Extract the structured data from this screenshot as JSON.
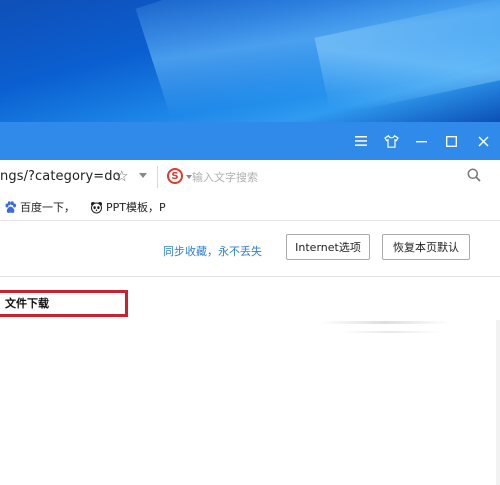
{
  "window_controls": {
    "menu_icon": "menu-icon",
    "skin_icon": "shirt-skin-icon",
    "minimize_icon": "minimize-icon",
    "maximize_icon": "maximize-icon",
    "close_icon": "close-icon"
  },
  "address_bar": {
    "url": "ngs/?category=do",
    "search_engine_icon": "sogou-s-icon",
    "search_placeholder": "输入文字搜索"
  },
  "favorites": [
    {
      "label": "百度一下，",
      "icon": "baidu-paw-icon"
    },
    {
      "label": "PPT模板，P",
      "icon": "panda-icon"
    }
  ],
  "settings": {
    "sync_link": "同步收藏，永不丢失",
    "internet_options_label": "Internet选项",
    "restore_default_label": "恢复本页默认",
    "download_item_label": "文件下载"
  },
  "colors": {
    "titlebar": "#2f8ae9",
    "link": "#2f7fd8",
    "highlight_box": "#c8222c"
  }
}
